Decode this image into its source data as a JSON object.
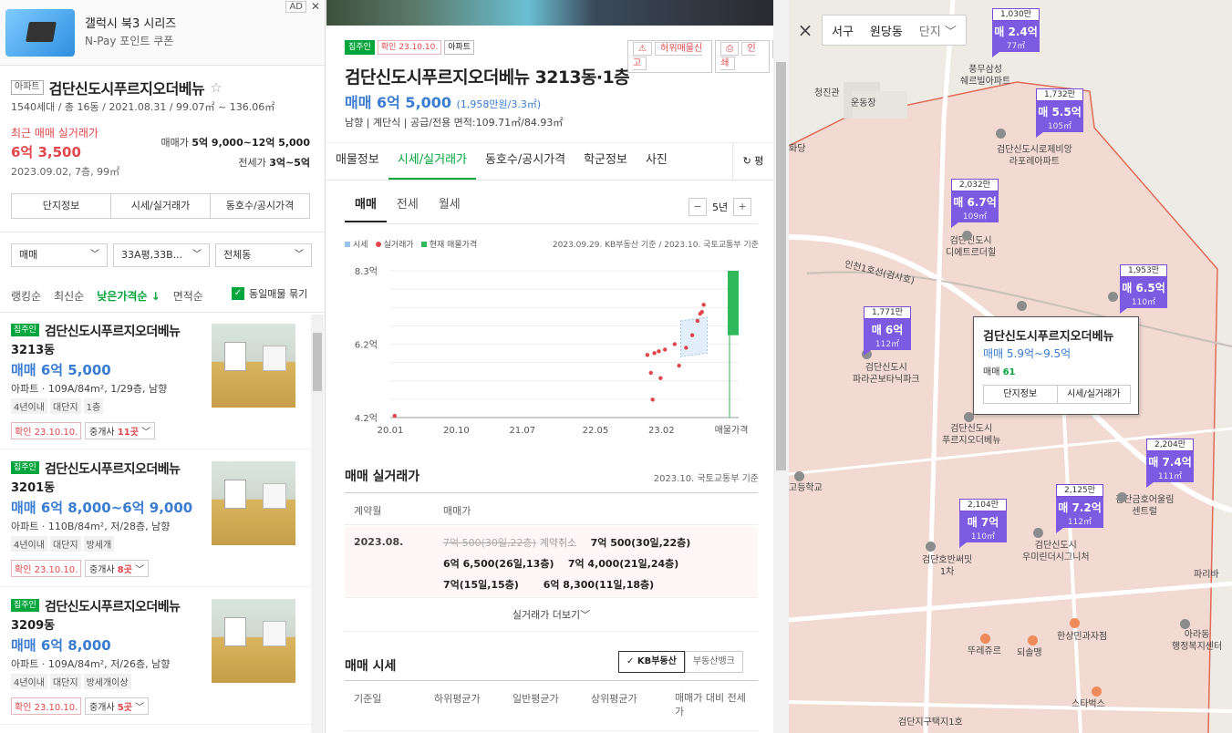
{
  "ad": {
    "title": "갤럭시 북3 시리즈",
    "subtitle": "N-Pay 포인트 쿠폰",
    "badge": "AD",
    "close": "✕"
  },
  "complex": {
    "type_tag": "아파트",
    "name": "검단신도시푸르지오더베뉴",
    "meta": "1540세대 / 총 16동 / 2021.08.31 / 99.07㎡ ~ 136.06㎡",
    "recent_label": "최근 매매 실거래가",
    "recent_value": "6억 3,500",
    "recent_detail": "2023.09.02, 7층, 99㎡",
    "sale_label": "매매가",
    "sale_range": "5억 9,000~12억 5,000",
    "jeonse_label": "전세가",
    "jeonse_range": "3억~5억",
    "buttons": [
      "단지정보",
      "시세/실거래가",
      "동호수/공시가격"
    ]
  },
  "filters": {
    "trade": "매매",
    "area": "33A평,33B...",
    "dong": "전체동"
  },
  "sorts": [
    "랭킹순",
    "최신순",
    "낮은가격순 ↓",
    "면적순"
  ],
  "same_merge": "동일매물 묶기",
  "listings": [
    {
      "badge": "집주인",
      "name": "검단신도시푸르지오더베뉴",
      "dong": "3213동",
      "price": "매매 6억 5,000",
      "desc": "아파트 · 109A/84m², 1/29층, 남향",
      "tags": [
        "4년이내",
        "대단지",
        "1층"
      ],
      "confirm": "확인 23.10.10.",
      "agent_label": "중개사",
      "agent_count": "11곳"
    },
    {
      "badge": "집주인",
      "name": "검단신도시푸르지오더베뉴",
      "dong": "3201동",
      "price": "매매 6억 8,000~6억 9,000",
      "desc": "아파트 · 110B/84m², 저/28층, 남향",
      "tags": [
        "4년이내",
        "대단지",
        "방세개"
      ],
      "confirm": "확인 23.10.10.",
      "agent_label": "중개사",
      "agent_count": "8곳"
    },
    {
      "badge": "집주인",
      "name": "검단신도시푸르지오더베뉴",
      "dong": "3209동",
      "price": "매매 6억 8,000",
      "desc": "아파트 · 109A/84m², 저/26층, 남향",
      "tags": [
        "4년이내",
        "대단지",
        "방세개이상"
      ],
      "confirm": "확인 23.10.10.",
      "agent_label": "중개사",
      "agent_count": "5곳"
    }
  ],
  "detail": {
    "badges": [
      "집주인",
      "확인 23.10.10.",
      "아파트"
    ],
    "report": "허위매물신고",
    "print": "인쇄",
    "title": "검단신도시푸르지오더베뉴 3213동·1층",
    "price": "매매 6억 5,000",
    "unit_price": "(1,958만원/3.3㎡)",
    "info": "남향  |  계단식  |  공급/전용 면적:109.71㎡/84.93㎡",
    "tabs": [
      "매물정보",
      "시세/실거래가",
      "동호수/공시가격",
      "학군정보",
      "사진"
    ],
    "tab_more": "평",
    "subtabs": [
      "매매",
      "전세",
      "월세"
    ],
    "period": "5년",
    "minus": "−",
    "plus": "+",
    "legend": [
      "시세",
      "실거래가",
      "현재 매물가격"
    ],
    "source": "2023.09.29. KB부동산 기준 / 2023.10. 국토교통부 기준",
    "trade_title": "매매 실거래가",
    "trade_source": "2023.10. 국토교통부 기준",
    "trade_cols": [
      "계약월",
      "매매가"
    ],
    "trade_month": "2023.08.",
    "trade_lines": [
      {
        "strike": "7억 500(30일,22층)",
        "cancel": "계약취소",
        "rest": "7억 500(30일,22층)"
      },
      {
        "a": "6억 6,500(26일,13층)",
        "b": "7억 4,000(21일,24층)"
      },
      {
        "a": "7억(15일,15층)",
        "b": "6억 8,300(11일,18층)"
      }
    ],
    "trade_more": "실거래가 더보기",
    "market_title": "매매 시세",
    "market_tabs": [
      "KB부동산",
      "부동산뱅크"
    ],
    "market_cols": [
      "기준일",
      "하위평균가",
      "일반평균가",
      "상위평균가",
      "매매가 대비 전세가"
    ]
  },
  "chart_data": {
    "type": "scatter",
    "title": "",
    "y_tick_labels": [
      "8.3억",
      "6.2억",
      "4.2억"
    ],
    "x_tick_labels": [
      "20.01",
      "20.10",
      "21.07",
      "22.05",
      "23.02",
      "매물가격"
    ],
    "ylim": [
      4.2,
      8.3
    ],
    "series": [
      {
        "name": "실거래가",
        "color": "#e0464c",
        "points": [
          [
            2020.05,
            4.25
          ],
          [
            2022.92,
            5.95
          ],
          [
            2022.96,
            5.45
          ],
          [
            2022.98,
            4.7
          ],
          [
            2023.0,
            6.0
          ],
          [
            2023.05,
            6.05
          ],
          [
            2023.07,
            5.3
          ],
          [
            2023.12,
            6.1
          ],
          [
            2023.23,
            6.25
          ],
          [
            2023.28,
            5.65
          ],
          [
            2023.36,
            6.15
          ],
          [
            2023.43,
            6.5
          ],
          [
            2023.49,
            6.9
          ],
          [
            2023.52,
            7.1
          ],
          [
            2023.54,
            7.15
          ],
          [
            2023.56,
            7.35
          ]
        ]
      },
      {
        "name": "시세",
        "color": "#9cc3e8"
      },
      {
        "name": "현재 매물가격",
        "color": "#2fb95a",
        "range": [
          6.5,
          8.3
        ]
      }
    ],
    "grid": true
  },
  "map": {
    "breadcrumb": [
      "서구",
      "원당동",
      "단지"
    ],
    "markers": [
      {
        "count": "1,030만",
        "price": "매 2.4억",
        "area": "77㎡"
      },
      {
        "count": "1,732만",
        "price": "매 5.5억",
        "area": "105㎡"
      },
      {
        "count": "2,032만",
        "price": "매 6.7억",
        "area": "109㎡"
      },
      {
        "count": "1,953만",
        "price": "매 6.5억",
        "area": "110㎡"
      },
      {
        "count": "1,771만",
        "price": "매 6억",
        "area": "112㎡"
      },
      {
        "count": "2,204만",
        "price": "매 7.4억",
        "area": "111㎡"
      },
      {
        "count": "2,125만",
        "price": "매 7.2억",
        "area": "112㎡"
      },
      {
        "count": "2,104만",
        "price": "매 7억",
        "area": "110㎡"
      }
    ],
    "popup": {
      "name": "검단신도시푸르지오더베뉴",
      "price": "매매 5.9억~9.5억",
      "count_label": "매매",
      "count": "61",
      "buttons": [
        "단지정보",
        "시세/실거래가"
      ]
    },
    "labels": [
      "풍무삼성\n쉐르빌아파트",
      "검단신도시로제비앙\n라포레아파트",
      "검단신도시\n디에트르더힐",
      "검단신도시\n파라곤보타닉파크",
      "검단신도시\n푸르지오더베뉴",
      "검단호반써밋\n1차",
      "검단신도시\n우미린더시그니처",
      "검단금호어울림\n센트럴",
      "청진관",
      "운동장",
      "화당",
      "롤레",
      "인천1호선(검사호)",
      "고등학교",
      "뚜레쥬르",
      "되솔맹",
      "한상민과자점",
      "스타벅스",
      "아라동\n행정복지센터",
      "파리바",
      "검단지구택지1호"
    ]
  },
  "colors": {
    "green": "#03a63c",
    "blue": "#3a7cd2",
    "red": "#e0464c",
    "marker": "#7c5ae2"
  }
}
